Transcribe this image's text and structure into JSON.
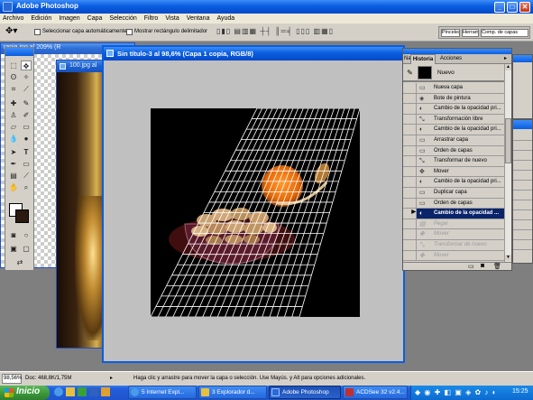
{
  "app": {
    "title": "Adobe Photoshop"
  },
  "menu": [
    "Archivo",
    "Edición",
    "Imagen",
    "Capa",
    "Selección",
    "Filtro",
    "Vista",
    "Ventana",
    "Ayuda"
  ],
  "options": {
    "auto_select_label": "Seleccionar capa automáticamente",
    "show_bounds_label": "Mostrar rectángulo delimitador",
    "palette_well": [
      "Pinceles",
      "Herramientas",
      "Comp. de capas"
    ]
  },
  "documents": {
    "back1_title": "ranja.jpg al 209% (R",
    "back2_title": "100.jpg al",
    "active_title": "Sin título-3 al 98,6% (Capa 1 copia, RGB/8)"
  },
  "history": {
    "tabs": [
      "Na",
      "Historia",
      "Acciones"
    ],
    "snapshot_label": "Nuevo",
    "items": [
      {
        "label": "Nueva capa",
        "icon": "layer-icon",
        "state": "normal"
      },
      {
        "label": "Bote de pintura",
        "icon": "paint-bucket-icon",
        "state": "normal"
      },
      {
        "label": "Cambio de la opacidad pri...",
        "icon": "opacity-icon",
        "state": "normal"
      },
      {
        "label": "Transformación libre",
        "icon": "transform-icon",
        "state": "normal"
      },
      {
        "label": "Cambio de la opacidad pri...",
        "icon": "opacity-icon",
        "state": "normal"
      },
      {
        "label": "Arrastrar capa",
        "icon": "layer-icon",
        "state": "normal"
      },
      {
        "label": "Orden de capas",
        "icon": "layer-icon",
        "state": "normal"
      },
      {
        "label": "Transformar de nuevo",
        "icon": "transform-icon",
        "state": "normal"
      },
      {
        "label": "Mover",
        "icon": "move-icon",
        "state": "normal"
      },
      {
        "label": "Cambio de la opacidad pri...",
        "icon": "opacity-icon",
        "state": "normal"
      },
      {
        "label": "Duplicar capa",
        "icon": "layer-icon",
        "state": "normal"
      },
      {
        "label": "Orden de capas",
        "icon": "layer-icon",
        "state": "normal"
      },
      {
        "label": "Cambio de la opacidad ...",
        "icon": "opacity-icon",
        "state": "selected"
      },
      {
        "label": "Pegar",
        "icon": "paste-icon",
        "state": "disabled"
      },
      {
        "label": "Mover",
        "icon": "move-icon",
        "state": "disabled"
      },
      {
        "label": "Transformar de nuevo",
        "icon": "transform-icon",
        "state": "disabled"
      },
      {
        "label": "Mover",
        "icon": "move-icon",
        "state": "disabled"
      }
    ]
  },
  "status": {
    "zoom": "98,56%",
    "doc": "Doc: 468,8K/1,75M",
    "hint": "Haga clic y arrastre para mover la capa o selección. Use Mayús. y Alt para opciones adicionales."
  },
  "taskbar": {
    "start": "Inicio",
    "tasks": [
      {
        "label": "5 Internet Expl...",
        "active": false
      },
      {
        "label": "3 Explorador d...",
        "active": false
      },
      {
        "label": "Adobe Photoshop",
        "active": true
      },
      {
        "label": "ACDSee 32 v2.4...",
        "active": false
      }
    ],
    "clock": "15:25"
  },
  "colors": {
    "xp_blue": "#0a5ee0",
    "selection": "#0a246a",
    "canvas_bg": "#000000",
    "grid": "#ffffff",
    "orange": "#f07a10"
  }
}
